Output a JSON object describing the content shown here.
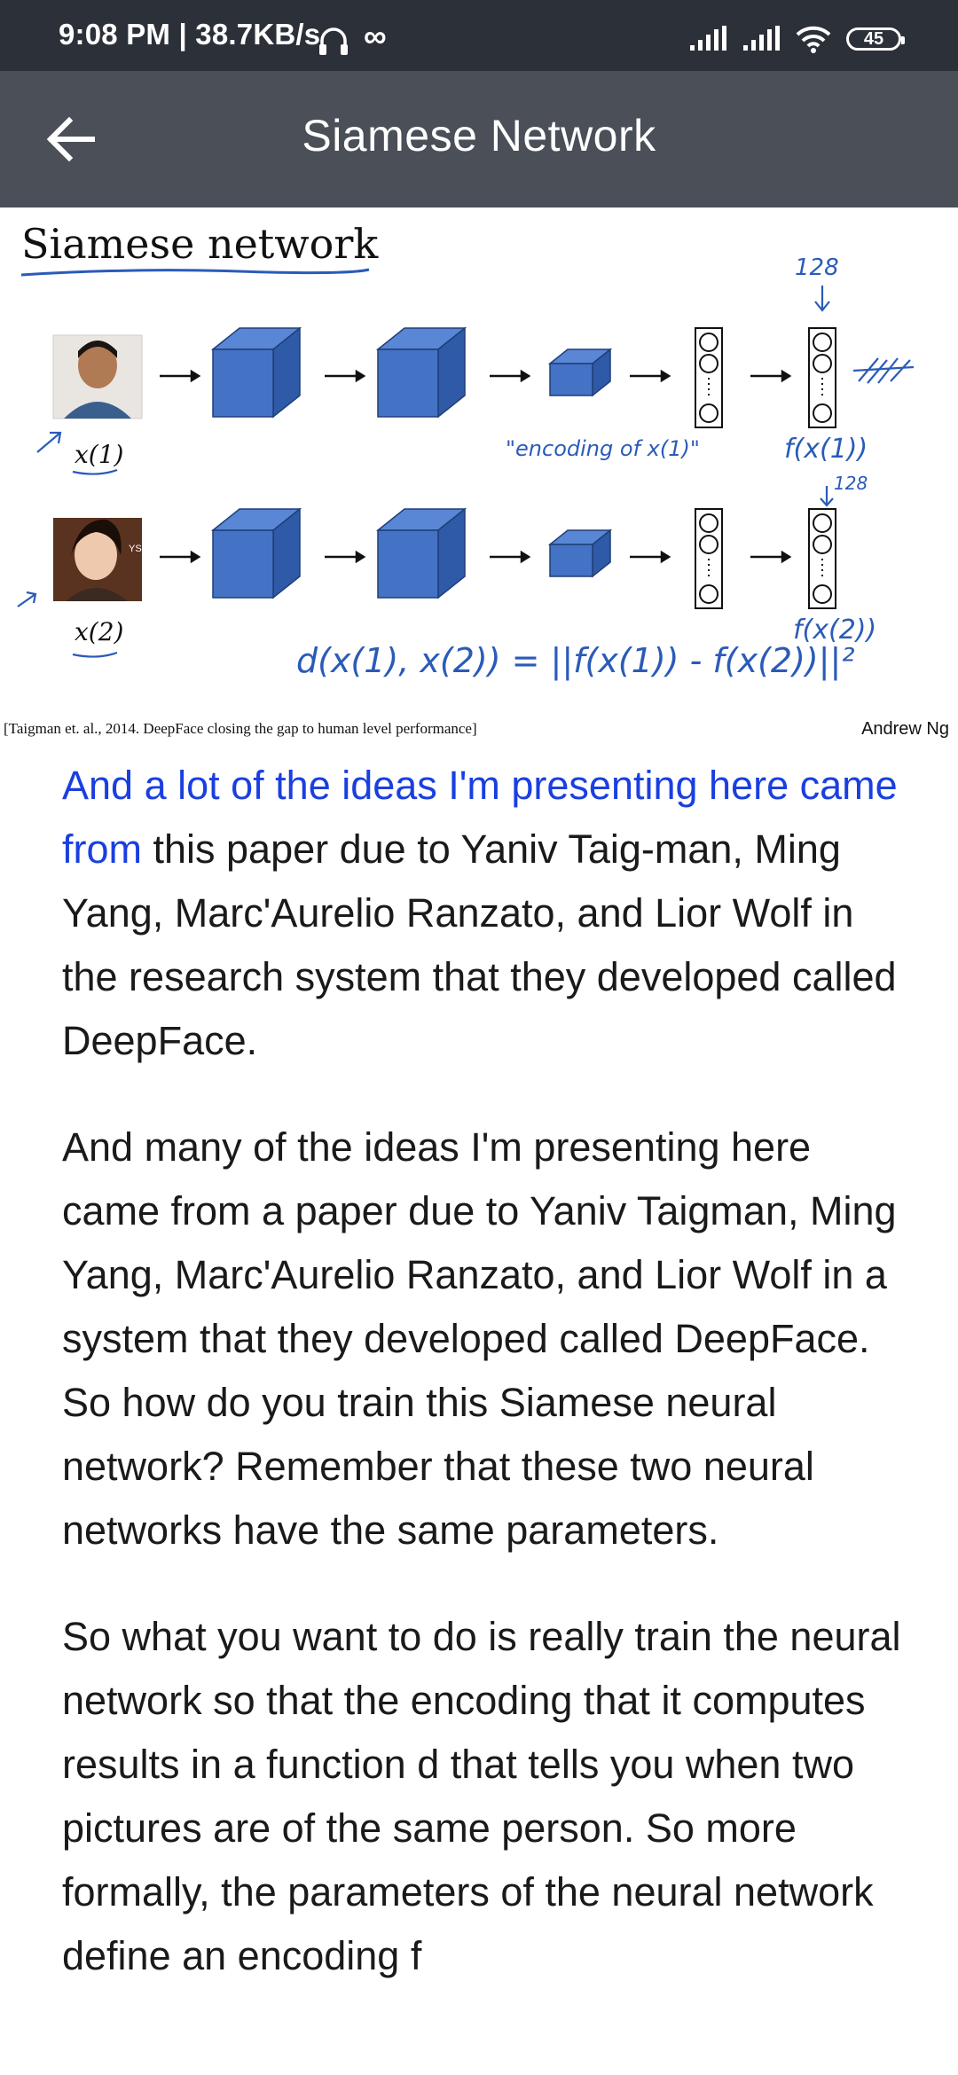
{
  "status_bar": {
    "time_network": "9:08 PM | 38.7KB/s",
    "infinity": "∞",
    "battery": "45"
  },
  "app_bar": {
    "title": "Siamese Network",
    "back_icon": "back-arrow-icon"
  },
  "slide": {
    "title": "Siamese network",
    "label_x1": "x(1)",
    "label_x2": "x(2)",
    "annotation_128_top": "128",
    "annotation_128_mid": "128",
    "annotation_encoding": "\"encoding of x(1)\"",
    "annotation_fx1": "f(x(1))",
    "annotation_fx2": "f(x(2))",
    "annotation_distance": "d(x(1), x(2)) = ||f(x(1)) - f(x(2))||²",
    "citation": "[Taigman et. al., 2014. DeepFace closing the gap to human level performance]",
    "author": "Andrew Ng"
  },
  "transcript": {
    "p1_highlight": "And a lot of the ideas I'm presenting here came from",
    "p1_rest": " this paper due to Yaniv Taig-man, Ming Yang, Marc'Aurelio Ranzato, and Lior Wolf in the research system that they developed called DeepFace.",
    "p2": "And many of the ideas I'm presenting here came from a paper due to Yaniv Taigman, Ming Yang, Marc'Aurelio Ranzato, and Lior Wolf in a system that they developed called DeepFace. So how do you train this Siamese neural network? Remember that these two neural networks have the same parameters.",
    "p3": "So what you want to do is really train the neural network so that the encoding that it computes results in a function d that tells you when two pictures are of the same person. So more formally, the parameters of the neural network define an encoding f"
  }
}
